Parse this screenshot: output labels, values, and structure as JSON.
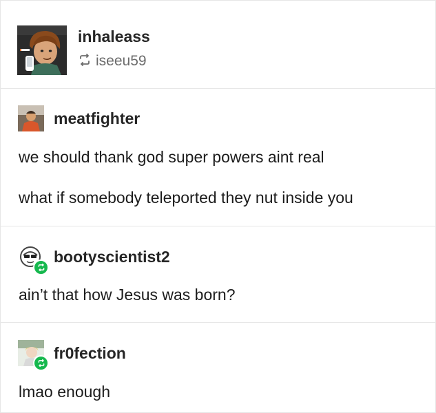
{
  "header": {
    "username": "inhaleass",
    "reblogged_from": "iseeu59",
    "reblog_icon": "reblog-icon"
  },
  "posts": [
    {
      "username": "meatfighter",
      "lines": [
        "we should thank god super powers aint real",
        "what if somebody teleported they nut inside you"
      ],
      "reblog_badge": false
    },
    {
      "username": "bootyscientist2",
      "lines": [
        "ain’t that how Jesus was born?"
      ],
      "reblog_badge": true
    },
    {
      "username": "fr0fection",
      "lines": [
        "lmao enough"
      ],
      "reblog_badge": true
    }
  ],
  "colors": {
    "badge": "#16b84e",
    "divider": "#e7e7e7",
    "text": "#1c1c1c",
    "muted": "#6b6b6b"
  }
}
